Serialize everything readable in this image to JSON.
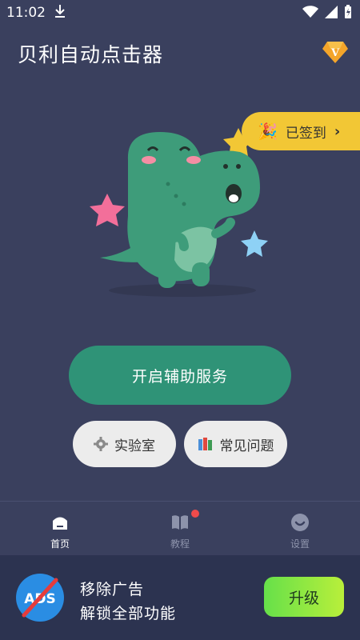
{
  "status_bar": {
    "time": "11:02"
  },
  "header": {
    "title": "贝利自动点击器",
    "vip_label": "V"
  },
  "checkin": {
    "label": "已签到"
  },
  "actions": {
    "primary_label": "开启辅助服务",
    "lab_label": "实验室",
    "faq_label": "常见问题"
  },
  "tabs": [
    {
      "label": "首页",
      "icon": "home-icon",
      "active": true
    },
    {
      "label": "教程",
      "icon": "book-icon",
      "active": false,
      "badge": true
    },
    {
      "label": "设置",
      "icon": "settings-icon",
      "active": false
    }
  ],
  "ad": {
    "icon_text": "ADS",
    "line1": "移除广告",
    "line2": "解锁全部功能",
    "upgrade_label": "升级"
  },
  "colors": {
    "background": "#3a405e",
    "primary": "#2f9377",
    "checkin": "#f2c735",
    "upgrade": "#8be342"
  }
}
